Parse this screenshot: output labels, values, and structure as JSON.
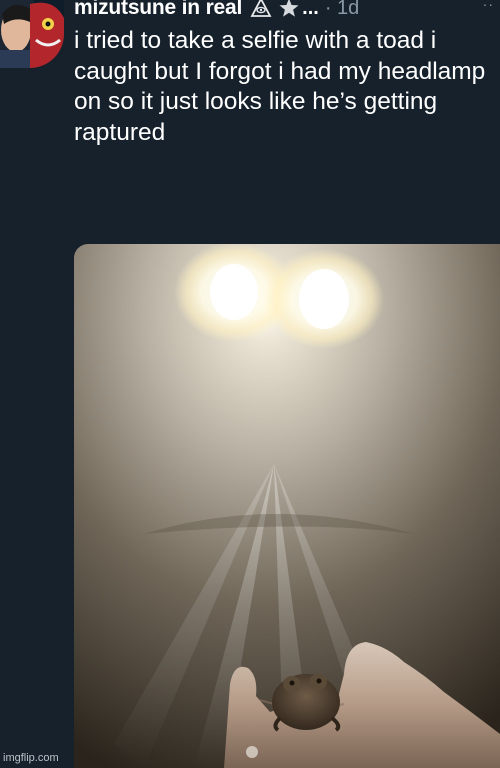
{
  "tweet": {
    "display_name": "mizutsune in real",
    "badge_icon": "triangle-symbol-icon",
    "star_icon": "star-icon",
    "ellipsis": "...",
    "timestamp": "· 1d",
    "more_label": "··",
    "text": "i tried to take a selfie with a toad i caught but I forgot i had my headlamp on so it just looks like he’s getting raptured"
  },
  "media": {
    "subject": "toad-photo"
  },
  "watermark": "imgflip.com"
}
